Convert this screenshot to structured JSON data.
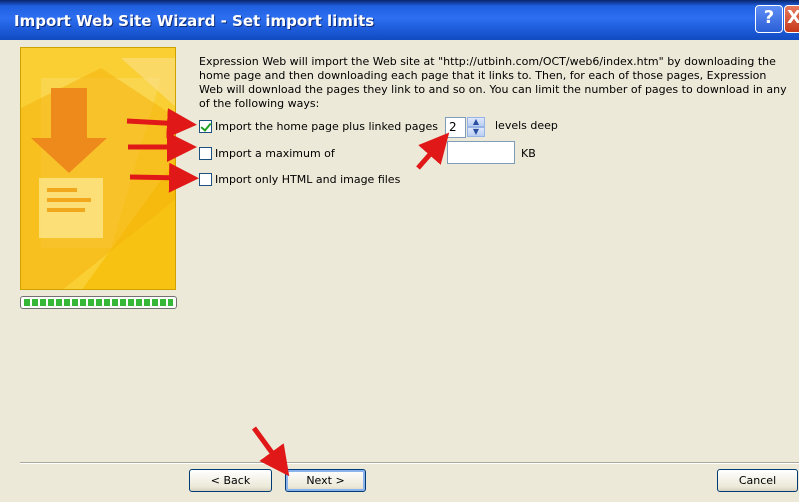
{
  "window": {
    "title": "Import Web Site Wizard - Set import limits",
    "help_label": "?",
    "close_label": "X"
  },
  "intro_text": "Expression Web will import the Web site at \"http://utbinh.com/OCT/web6/index.htm\" by downloading the home page and then downloading each page that it links to.  Then, for each of those pages, Expression Web will download the pages they link to and so on.  You can limit the number of pages to download in any of the following ways:",
  "options": [
    {
      "label": "Import the home page plus linked pages",
      "checked": true
    },
    {
      "label": "Import a maximum of",
      "checked": false
    },
    {
      "label": "Import only HTML and image files",
      "checked": false
    }
  ],
  "levels": {
    "value": "2",
    "suffix": "levels deep"
  },
  "max_size": {
    "value": "",
    "unit": "KB"
  },
  "progress_fraction": 1.0,
  "buttons": {
    "back": "< Back",
    "next": "Next >",
    "cancel": "Cancel"
  },
  "colors": {
    "title_bar": "#2d6ff0",
    "annotation_arrow": "#e01818",
    "wizard_art": "#f7c212",
    "progress": "#37b737"
  }
}
